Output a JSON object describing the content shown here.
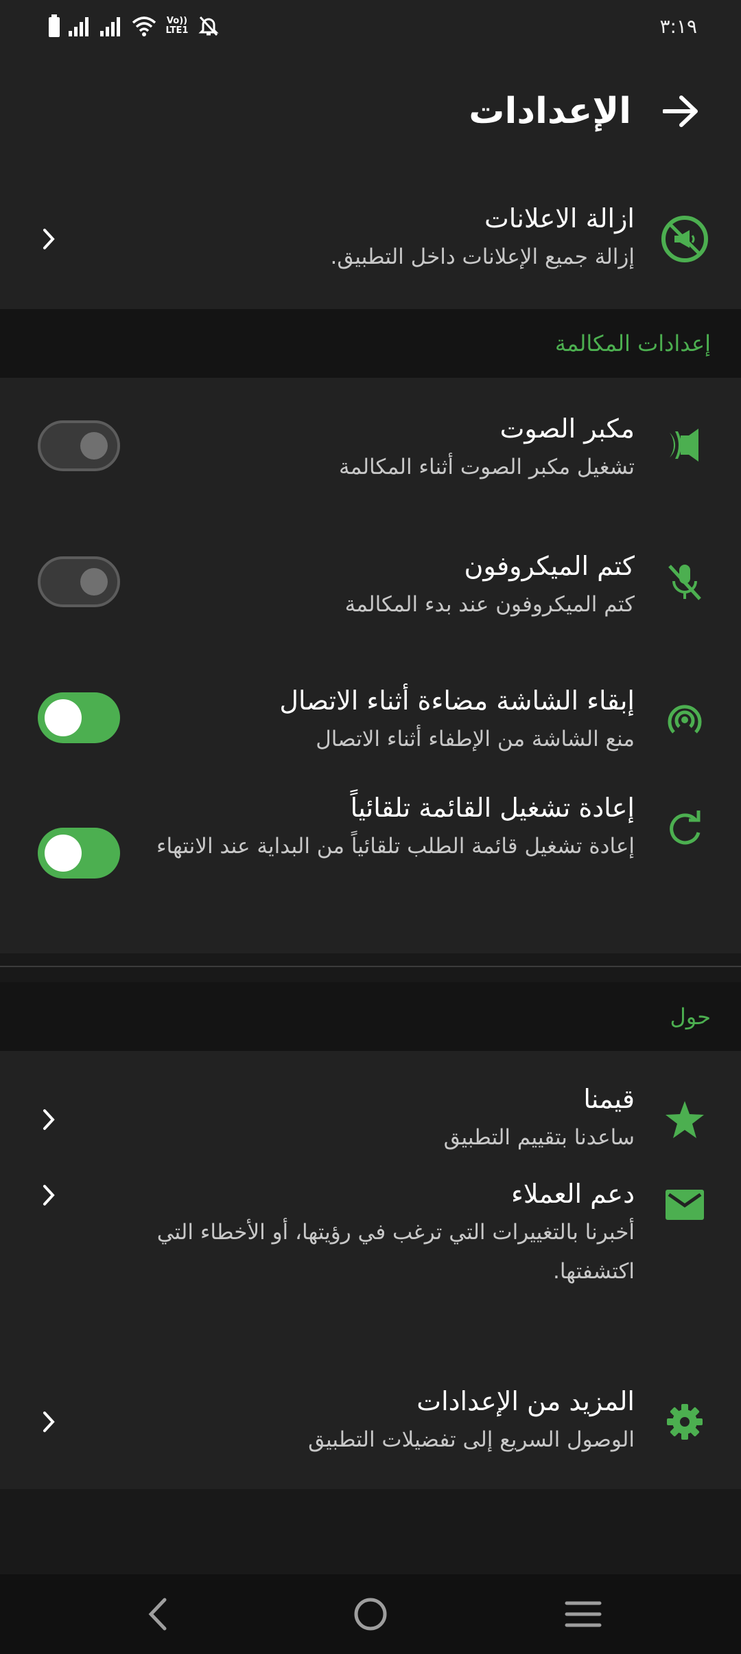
{
  "status_bar": {
    "time": "٣:١٩",
    "icons": [
      "battery-icon",
      "signal-icon",
      "signal-icon",
      "wifi-icon",
      "volte-icon",
      "bell-off-icon"
    ],
    "volte_label": "Vo)) LTE1"
  },
  "header": {
    "title": "الإعدادات",
    "back_icon": "arrow-forward-icon"
  },
  "ads_row": {
    "title": "ازالة الاعلانات",
    "subtitle": "إزالة جميع الإعلانات داخل التطبيق.",
    "icon": "no-ads-icon"
  },
  "call_settings": {
    "header": "إعدادات المكالمة",
    "items": [
      {
        "title": "مكبر الصوت",
        "subtitle": "تشغيل مكبر الصوت أثناء المكالمة",
        "icon": "speaker-icon",
        "enabled": false
      },
      {
        "title": "كتم الميكروفون",
        "subtitle": "كتم الميكروفون عند بدء المكالمة",
        "icon": "mic-off-icon",
        "enabled": false
      },
      {
        "title": "إبقاء الشاشة مضاءة أثناء الاتصال",
        "subtitle": "منع الشاشة من الإطفاء أثناء الاتصال",
        "icon": "broadcast-icon",
        "enabled": true
      },
      {
        "title": "إعادة تشغيل القائمة تلقائياً",
        "subtitle": "إعادة تشغيل قائمة الطلب تلقائياً من البداية عند الانتهاء",
        "icon": "refresh-icon",
        "enabled": true
      }
    ]
  },
  "about": {
    "header": "حول",
    "items": [
      {
        "title": "قيمنا",
        "subtitle": "ساعدنا بتقييم التطبيق",
        "icon": "star-icon"
      },
      {
        "title": "دعم العملاء",
        "subtitle": "أخبرنا بالتغييرات التي ترغب في رؤيتها، أو الأخطاء التي اكتشفتها.",
        "icon": "mail-icon"
      },
      {
        "title": "المزيد من الإعدادات",
        "subtitle": "الوصول السريع إلى تفضيلات التطبيق",
        "icon": "gear-icon"
      }
    ]
  },
  "colors": {
    "accent": "#4caf50",
    "background": "#191919",
    "surface": "#222222",
    "section_header": "#141414"
  }
}
